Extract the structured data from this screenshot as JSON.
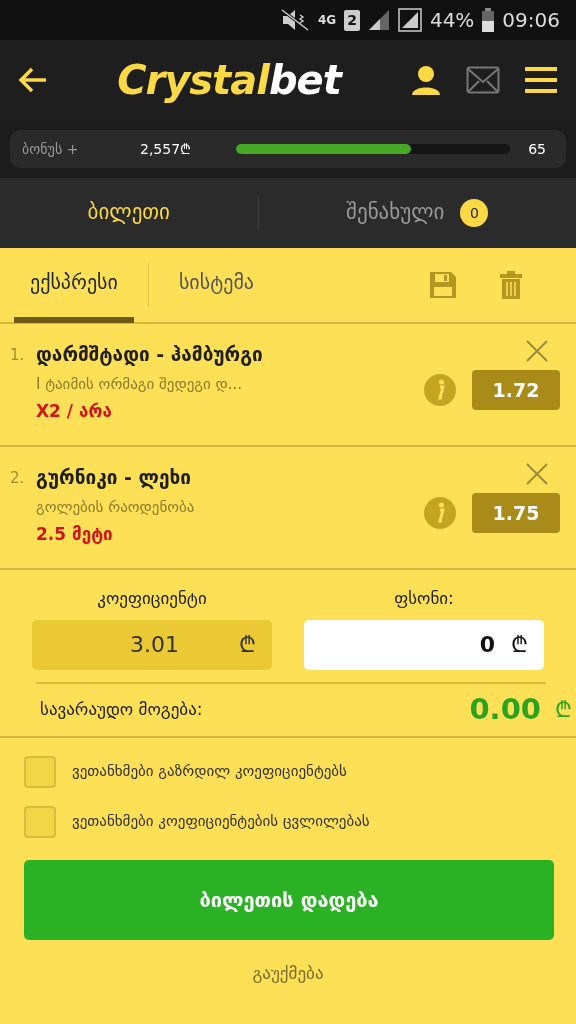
{
  "status_bar": {
    "network": "4G",
    "sim": "2",
    "battery": "44%",
    "time": "09:06"
  },
  "header": {
    "logo": "Crystal",
    "logo_accent": "bet"
  },
  "bonus": {
    "label": "ბონუს +",
    "amount": "2,557₾",
    "level": 0.64,
    "count": "65"
  },
  "main_tabs": [
    {
      "label": "ბილეთი",
      "selected": true
    },
    {
      "label": "შენახული",
      "selected": false,
      "badge": "0"
    }
  ],
  "bet_tabs": [
    {
      "label": "ექსპრესი",
      "selected": true
    },
    {
      "label": "სისტემა",
      "selected": false
    }
  ],
  "bets": [
    {
      "number": "1.",
      "match": "დარმშტადი - ჰამბურგი",
      "market": "I ტაიმის ორმაგი შედეგი დ...",
      "pick": "X2 / არა",
      "odds": "1.72"
    },
    {
      "number": "2.",
      "match": "გურნიკი - ლეხი",
      "market": "გოლების რაოდენობა",
      "pick": "2.5 მეტი",
      "odds": "1.75"
    }
  ],
  "totals": {
    "odds_label": "კოეფიციენტი",
    "odds": "3.01",
    "odds_currency": "₾",
    "stake_label": "ფსონი:",
    "stake": "0",
    "stake_currency": "₾",
    "potential_label": "სავარაუდო მოგება:",
    "potential": "0.00",
    "potential_currency": "₾"
  },
  "agreements": [
    {
      "label": "ვეთანხმები გაზრდილ კოეფიციენტებს",
      "checked": false
    },
    {
      "label": "ვეთანხმები კოეფიციენტების ცვლილებას",
      "checked": false
    }
  ],
  "place_button": "ბილეთის დადება",
  "cancel": "გაუქმება"
}
